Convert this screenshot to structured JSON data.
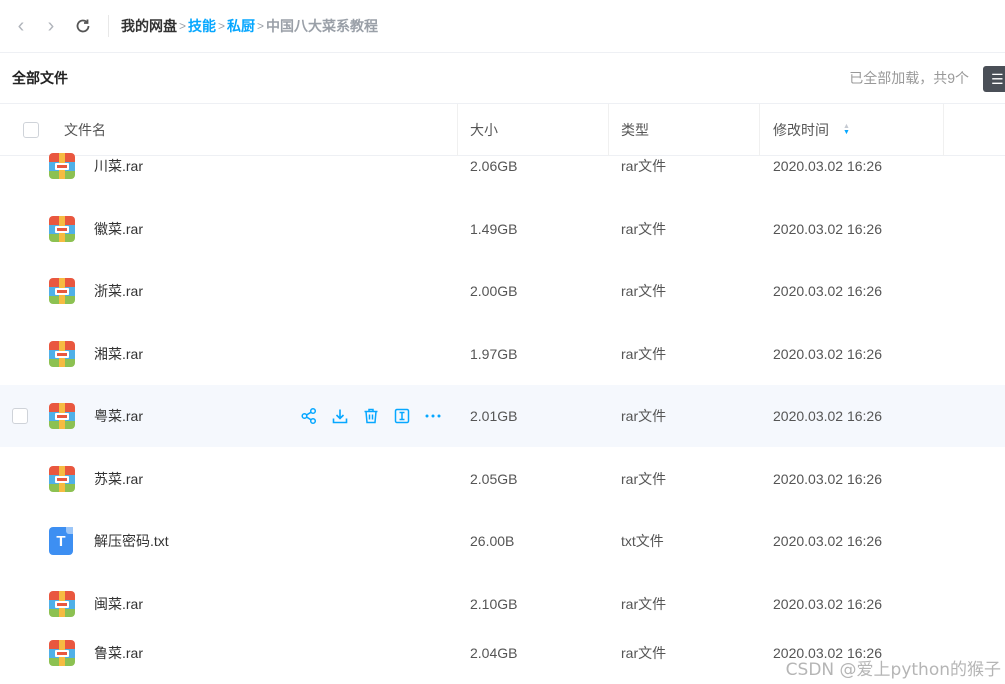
{
  "toolbar": {
    "back_icon": "chevron-left-icon",
    "forward_icon": "chevron-right-icon",
    "refresh_icon": "refresh-icon"
  },
  "breadcrumb": {
    "root": "我的网盘",
    "items": [
      "技能",
      "私厨"
    ],
    "current": "中国八大菜系教程",
    "separator": ">"
  },
  "section": {
    "title": "全部文件",
    "status": "已全部加载，共9个"
  },
  "table": {
    "headers": {
      "name": "文件名",
      "size": "大小",
      "type": "类型",
      "modified": "修改时间"
    },
    "rows": [
      {
        "name": "川菜.rar",
        "size": "2.06GB",
        "type": "rar文件",
        "modified": "2020.03.02 16:26",
        "icon": "rar-icon"
      },
      {
        "name": "徽菜.rar",
        "size": "1.49GB",
        "type": "rar文件",
        "modified": "2020.03.02 16:26",
        "icon": "rar-icon"
      },
      {
        "name": "浙菜.rar",
        "size": "2.00GB",
        "type": "rar文件",
        "modified": "2020.03.02 16:26",
        "icon": "rar-icon"
      },
      {
        "name": "湘菜.rar",
        "size": "1.97GB",
        "type": "rar文件",
        "modified": "2020.03.02 16:26",
        "icon": "rar-icon"
      },
      {
        "name": "粤菜.rar",
        "size": "2.01GB",
        "type": "rar文件",
        "modified": "2020.03.02 16:26",
        "icon": "rar-icon",
        "hovered": true
      },
      {
        "name": "苏菜.rar",
        "size": "2.05GB",
        "type": "rar文件",
        "modified": "2020.03.02 16:26",
        "icon": "rar-icon"
      },
      {
        "name": "解压密码.txt",
        "size": "26.00B",
        "type": "txt文件",
        "modified": "2020.03.02 16:26",
        "icon": "txt-icon",
        "icon_letter": "T"
      },
      {
        "name": "闽菜.rar",
        "size": "2.10GB",
        "type": "rar文件",
        "modified": "2020.03.02 16:26",
        "icon": "rar-icon"
      },
      {
        "name": "鲁菜.rar",
        "size": "2.04GB",
        "type": "rar文件",
        "modified": "2020.03.02 16:26",
        "icon": "rar-icon"
      }
    ],
    "row_actions": [
      "share-icon",
      "download-icon",
      "delete-icon",
      "rename-icon",
      "more-icon"
    ]
  },
  "watermark": "CSDN @爱上python的猴子",
  "colors": {
    "accent": "#06a7ff",
    "hover_row": "#f5f8fd",
    "breadcrumb_current": "#9aa0a8"
  }
}
